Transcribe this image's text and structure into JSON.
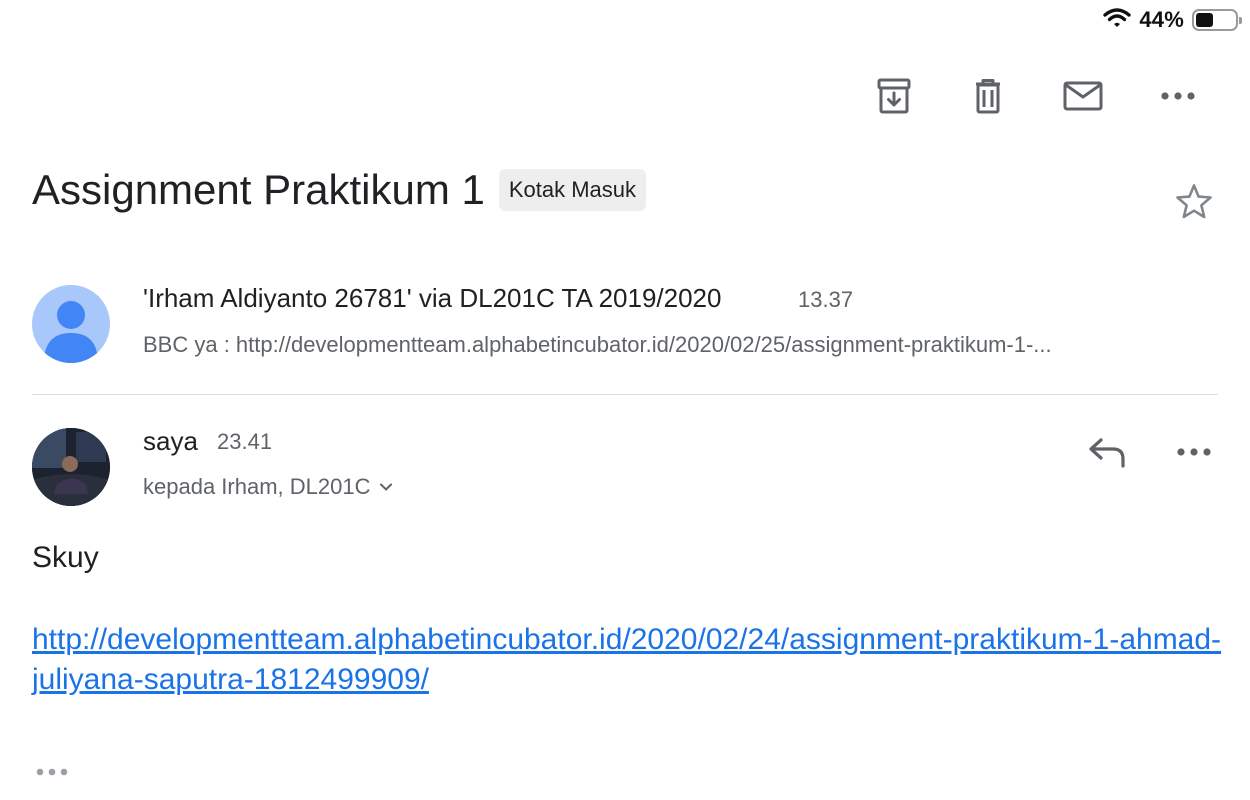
{
  "status_bar": {
    "battery_percent": "44%",
    "battery_level": 0.44
  },
  "toolbar": {
    "archive_icon": "archive-icon",
    "delete_icon": "trash-icon",
    "mark_unread_icon": "mail-icon",
    "more_icon": "more-horizontal-icon"
  },
  "thread": {
    "subject": "Assignment Praktikum 1",
    "label": "Kotak Masuk"
  },
  "messages": [
    {
      "sender": "'Irham Aldiyanto 26781' via DL201C TA 2019/2020",
      "time": "13.37",
      "snippet": "BBC ya : http://developmentteam.alphabetincubator.id/2020/02/25/assignment-praktikum-1-..."
    },
    {
      "sender": "saya",
      "time": "23.41",
      "recipients": "kepada Irham, DL201C",
      "body": "Skuy",
      "link": "http://developmentteam.alphabetincubator.id/2020/02/24/assignment-praktikum-1-ahmad-juliyana-saputra-1812499909/"
    }
  ],
  "colors": {
    "link": "#1a73e8",
    "avatar_default_bg": "#a8c7fa",
    "avatar_default_fg": "#4285f4",
    "secondary_text": "#5f6368"
  }
}
